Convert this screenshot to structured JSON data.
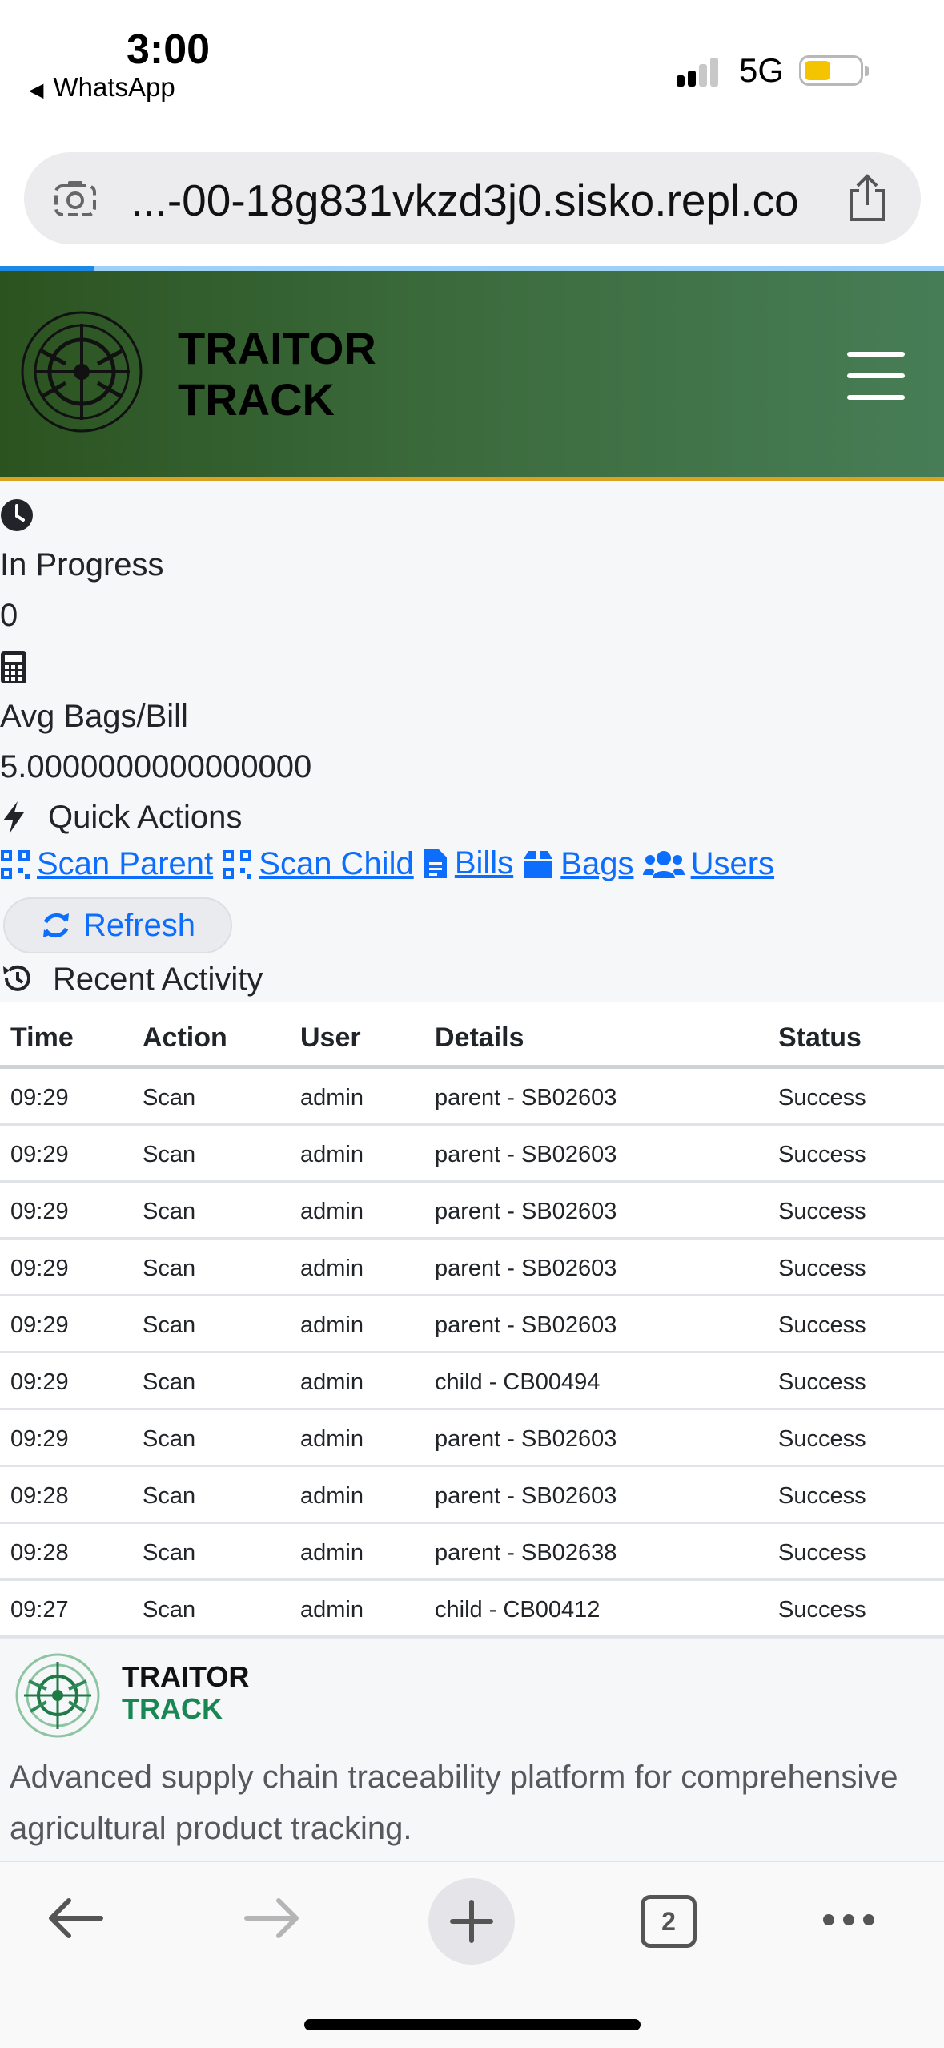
{
  "status_bar": {
    "time": "3:00",
    "back_app": "WhatsApp",
    "network": "5G"
  },
  "browser": {
    "url": "...-00-18g831vkzd3j0.sisko.repl.co",
    "tab_count": "2"
  },
  "header": {
    "brand_line1": "TRAITOR",
    "brand_line2": "TRACK"
  },
  "stats": [
    {
      "label": "In Progress",
      "value": "0",
      "icon": "clock-icon"
    },
    {
      "label": "Avg Bags/Bill",
      "value": "5.0000000000000000",
      "icon": "calculator-icon"
    }
  ],
  "quick_actions": {
    "title": "Quick Actions",
    "links": [
      "Scan Parent",
      "Scan Child",
      "Bills",
      "Bags",
      "Users"
    ],
    "refresh_label": "Refresh"
  },
  "recent_activity": {
    "title": "Recent Activity",
    "columns": [
      "Time",
      "Action",
      "User",
      "Details",
      "Status"
    ],
    "rows": [
      [
        "09:29",
        "Scan",
        "admin",
        "parent - SB02603",
        "Success"
      ],
      [
        "09:29",
        "Scan",
        "admin",
        "parent - SB02603",
        "Success"
      ],
      [
        "09:29",
        "Scan",
        "admin",
        "parent - SB02603",
        "Success"
      ],
      [
        "09:29",
        "Scan",
        "admin",
        "parent - SB02603",
        "Success"
      ],
      [
        "09:29",
        "Scan",
        "admin",
        "parent - SB02603",
        "Success"
      ],
      [
        "09:29",
        "Scan",
        "admin",
        "child - CB00494",
        "Success"
      ],
      [
        "09:29",
        "Scan",
        "admin",
        "parent - SB02603",
        "Success"
      ],
      [
        "09:28",
        "Scan",
        "admin",
        "parent - SB02603",
        "Success"
      ],
      [
        "09:28",
        "Scan",
        "admin",
        "parent - SB02638",
        "Success"
      ],
      [
        "09:27",
        "Scan",
        "admin",
        "child - CB00412",
        "Success"
      ]
    ]
  },
  "footer": {
    "brand_line1": "TRAITOR",
    "brand_line2": "TRACK",
    "description": "Advanced supply chain traceability platform for comprehensive agricultural product tracking."
  },
  "colors": {
    "link": "#0d6efd",
    "header_start": "#2b5320",
    "header_end": "#477d56",
    "accent": "#d9a320",
    "footer_green": "#198754"
  }
}
